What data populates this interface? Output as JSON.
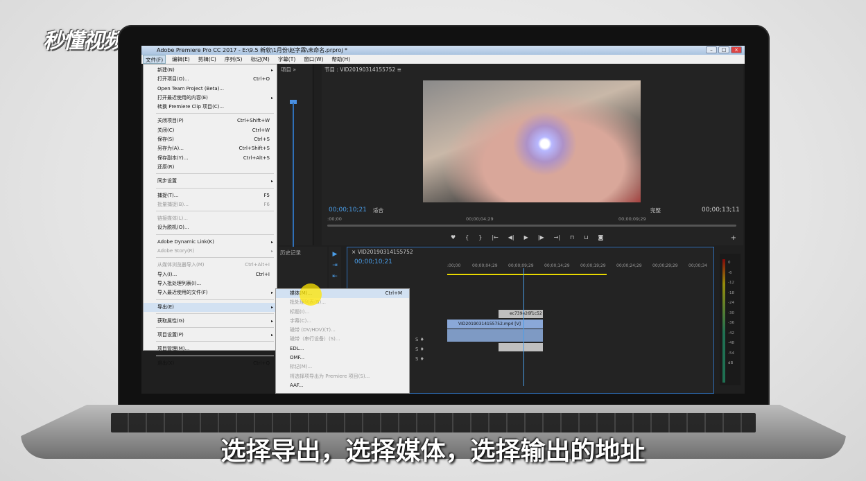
{
  "brand": {
    "logo_text": "秒懂视频"
  },
  "window": {
    "title": "Adobe Premiere Pro CC 2017 - E:\\9.5 新软\\1月份\\赵字霖\\未命名.prproj *",
    "min": "–",
    "max": "□",
    "close": "×"
  },
  "menubar": [
    "文件(F)",
    "编辑(E)",
    "剪辑(C)",
    "序列(S)",
    "标记(M)",
    "字幕(T)",
    "窗口(W)",
    "帮助(H)"
  ],
  "file_menu": {
    "items": [
      {
        "label": "新建(N)",
        "arrow": "▸"
      },
      {
        "label": "打开项目(O)...",
        "shortcut": "Ctrl+O"
      },
      {
        "label": "Open Team Project (Beta)..."
      },
      {
        "label": "打开最近使用的内容(E)",
        "arrow": "▸"
      },
      {
        "label": "转换 Premiere Clip 项目(C)..."
      },
      {
        "label": "关闭项目(P)",
        "shortcut": "Ctrl+Shift+W"
      },
      {
        "label": "关闭(C)",
        "shortcut": "Ctrl+W"
      },
      {
        "label": "保存(S)",
        "shortcut": "Ctrl+S"
      },
      {
        "label": "另存为(A)...",
        "shortcut": "Ctrl+Shift+S"
      },
      {
        "label": "保存副本(Y)...",
        "shortcut": "Ctrl+Alt+S"
      },
      {
        "label": "还原(R)"
      },
      {
        "label": "同步设置",
        "arrow": "▸"
      },
      {
        "label": "捕捉(T)...",
        "shortcut": "F5"
      },
      {
        "label": "批量捕捉(B)...",
        "shortcut": "F6"
      },
      {
        "label": "链接媒体(L)..."
      },
      {
        "label": "设为脱机(O)..."
      },
      {
        "label": "Adobe Dynamic Link(K)",
        "arrow": "▸"
      },
      {
        "label": "Adobe Story(R)",
        "arrow": "▸"
      },
      {
        "label": "从媒体浏览器导入(M)",
        "shortcut": "Ctrl+Alt+I"
      },
      {
        "label": "导入(I)...",
        "shortcut": "Ctrl+I"
      },
      {
        "label": "导入批处理列表(I)..."
      },
      {
        "label": "导入最近使用的文件(F)",
        "arrow": "▸"
      },
      {
        "label": "导出(E)",
        "arrow": "▸"
      },
      {
        "label": "获取属性(G)",
        "arrow": "▸"
      },
      {
        "label": "项目设置(P)",
        "arrow": "▸"
      },
      {
        "label": "项目管理(M)..."
      },
      {
        "label": "退出(X)",
        "shortcut": "Ctrl+Q"
      }
    ]
  },
  "export_menu": {
    "items": [
      {
        "label": "媒体(M)...",
        "shortcut": "Ctrl+M"
      },
      {
        "label": "批处理列表(B)..."
      },
      {
        "label": "标题(I)..."
      },
      {
        "label": "字幕(C)..."
      },
      {
        "label": "磁带 (DV/HDV)(T)..."
      },
      {
        "label": "磁带（串行设备）(S)..."
      },
      {
        "label": "EDL..."
      },
      {
        "label": "OMF..."
      },
      {
        "label": "标记(M)..."
      },
      {
        "label": "将选择项导出为 Premiere 项目(S)..."
      },
      {
        "label": "AAF..."
      }
    ]
  },
  "project_panel": {
    "tab": "项目",
    "expand": "»"
  },
  "program_monitor": {
    "tab": "节目 : VID20190314155752",
    "menu": "≡",
    "timecode_left": "00;00;10;21",
    "fit": "适合",
    "quality": "完整",
    "timecode_right": "00;00;13;11",
    "ruler": [
      ":00;00",
      "00;00;04;29",
      "00;00;09;29"
    ],
    "transport": [
      "♥",
      "{",
      "}",
      "|←",
      "◀|",
      "▶",
      "|▶",
      "→|",
      "⊓",
      "⊔",
      "◙"
    ],
    "add": "+"
  },
  "history_panel": {
    "tab": "历史记录"
  },
  "timeline": {
    "tab": "VID20190314155752",
    "close": "×",
    "timecode": "00;00;10;21",
    "ruler": [
      ":00;00",
      "00;00;04;29",
      "00;00;09;29",
      "00;00;14;29",
      "00;00;19;29",
      "00;00;24;29",
      "00;00;29;29",
      "00;00;34"
    ],
    "clip_v2": "ec739e26f1c52",
    "clip_v1": "VID20190314155752.mp4 [V]"
  },
  "meter_labels": [
    "0",
    "-6",
    "-12",
    "-18",
    "-24",
    "-30",
    "-36",
    "-42",
    "-48",
    "-54",
    "dB"
  ],
  "subtitle": "选择导出，选择媒体，选择输出的地址"
}
